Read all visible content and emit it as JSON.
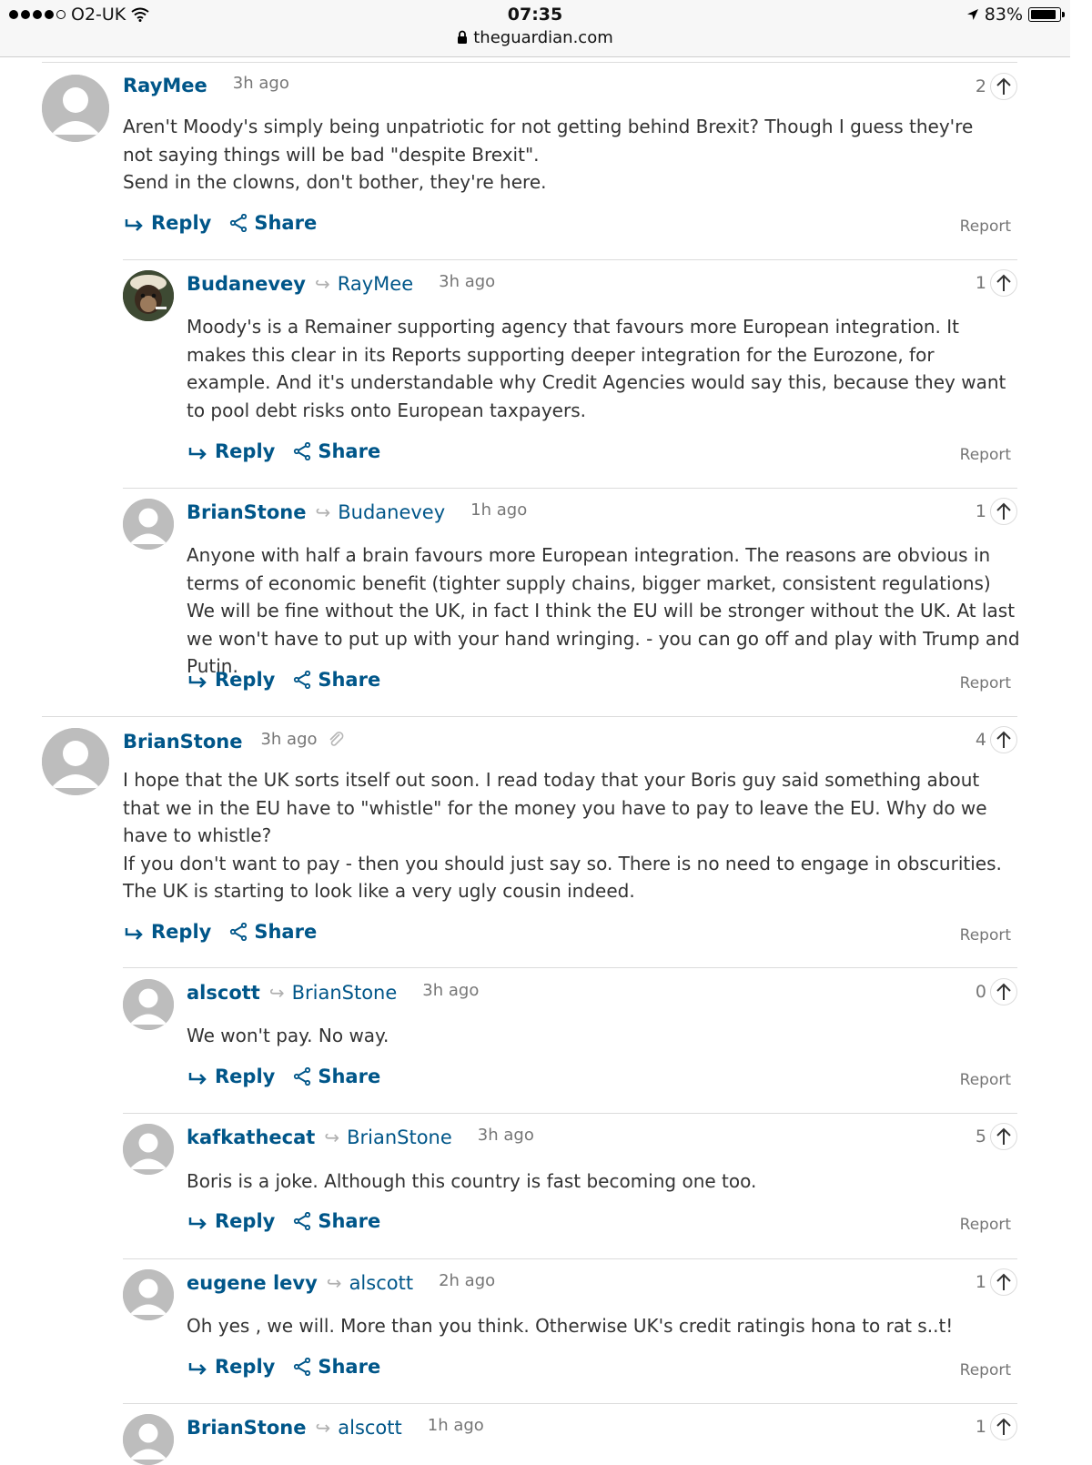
{
  "status_bar": {
    "carrier": "O2-UK",
    "time": "07:35",
    "url": "theguardian.com",
    "battery": "83%"
  },
  "labels": {
    "reply": "Reply",
    "share": "Share",
    "report": "Report"
  },
  "comments": [
    {
      "author": "RayMee",
      "reply_to": "",
      "time": "3h ago",
      "votes": "2",
      "paragraphs": [
        "Aren't Moody's simply being unpatriotic for not getting behind Brexit? Though I guess they're not saying things will be bad \"despite Brexit\".",
        "Send in the clowns, don't bother, they're here."
      ]
    },
    {
      "author": "Budanevey",
      "reply_to": "RayMee",
      "time": "3h ago",
      "votes": "1",
      "paragraphs": [
        "Moody's is a Remainer supporting agency that favours more European integration. It makes this clear in its Reports supporting deeper integration for the Eurozone, for example. And it's understandable why Credit Agencies would say this, because they want to pool debt risks onto European taxpayers."
      ]
    },
    {
      "author": "BrianStone",
      "reply_to": "Budanevey",
      "time": "1h ago",
      "votes": "1",
      "paragraphs": [
        "Anyone with half a brain favours more European integration. The reasons are obvious in terms of economic benefit (tighter supply chains, bigger market, consistent regulations) We will be fine without the UK, in fact I think the EU will be stronger without the UK. At last we won't have to put up with your hand wringing. - you can go off and play with Trump and Putin."
      ]
    },
    {
      "author": "BrianStone",
      "reply_to": "",
      "time": "3h ago",
      "votes": "4",
      "paragraphs": [
        "I hope that the UK sorts itself out soon. I read today that your Boris guy said something about that we in the EU have to \"whistle\" for the money you have to pay to leave the EU. Why do we have to whistle?",
        "If you don't want to pay - then you should just say so. There is no need to engage in obscurities. The UK is starting to look like a very ugly cousin indeed."
      ]
    },
    {
      "author": "alscott",
      "reply_to": "BrianStone",
      "time": "3h ago",
      "votes": "0",
      "paragraphs": [
        "We won't pay. No way."
      ]
    },
    {
      "author": "kafkathecat",
      "reply_to": "BrianStone",
      "time": "3h ago",
      "votes": "5",
      "paragraphs": [
        "Boris is a joke. Although this country is fast becoming one too."
      ]
    },
    {
      "author": "eugene levy",
      "reply_to": "alscott",
      "time": "2h ago",
      "votes": "1",
      "paragraphs": [
        "Oh yes , we will. More than you think. Otherwise UK's credit ratingis hona to rat s..t!"
      ]
    },
    {
      "author": "BrianStone",
      "reply_to": "alscott",
      "time": "1h ago",
      "votes": "1",
      "paragraphs": []
    }
  ]
}
